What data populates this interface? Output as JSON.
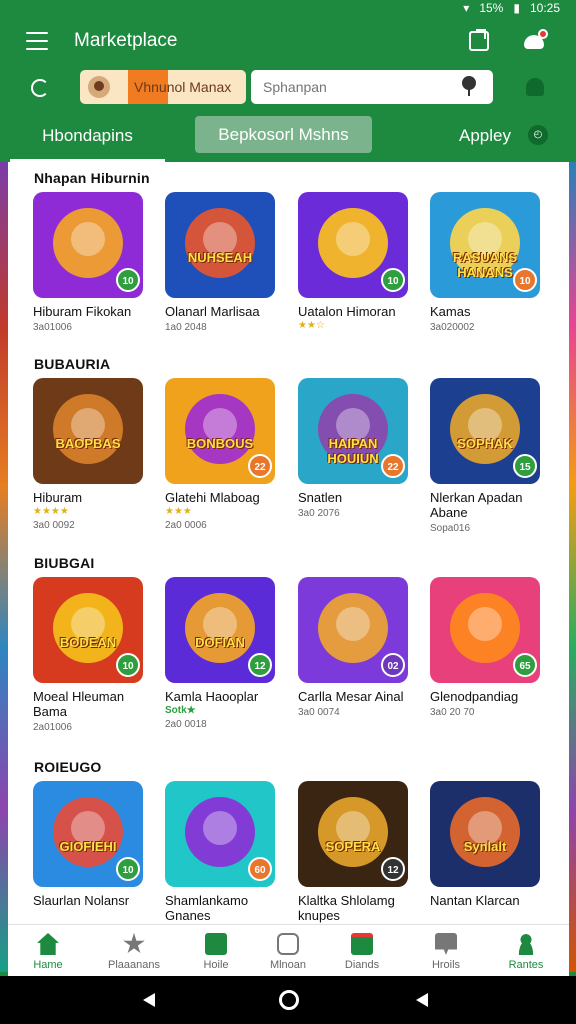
{
  "status_bar": {
    "battery": "15%",
    "time": "10:25"
  },
  "header": {
    "title": "Marketplace"
  },
  "search": {
    "chip_label": "Vhnunol Manax",
    "placeholder": "Sphanpan"
  },
  "tabs": [
    {
      "label": "Hbondapins"
    },
    {
      "label": "Bepkosorl Mshns"
    },
    {
      "label": "Appley"
    }
  ],
  "sections": [
    {
      "title": "Nhapan Hiburnin",
      "apps": [
        {
          "name": "Hiburam Fikokan",
          "meta": "3a01006",
          "rating": "",
          "badge": "10",
          "word": "",
          "bg": "#8e2bd6",
          "glow": "#f5a623",
          "badge_color": "#2e9e3e"
        },
        {
          "name": "Olanarl Marlisaa",
          "meta": "1a0 2048",
          "rating": "",
          "badge": "",
          "word": "NUHSEAH",
          "bg": "#1f4fb8",
          "glow": "#e8552c",
          "badge_color": "#2e9e3e"
        },
        {
          "name": "Uatalon Himoran",
          "meta": "",
          "rating": "★★☆",
          "badge": "10",
          "word": "",
          "bg": "#6c2bd9",
          "glow": "#ffc21a",
          "badge_color": "#2e9e3e"
        },
        {
          "name": "Kamas",
          "meta": "3a020002",
          "rating": "",
          "badge": "10",
          "word": "RASUANS HANANS",
          "bg": "#2a9bd8",
          "glow": "#ffd54a",
          "badge_color": "#e8762c"
        }
      ]
    },
    {
      "title": "BUBAURIA",
      "apps": [
        {
          "name": "Hiburam",
          "meta": "3a0 0092",
          "rating": "★★★★",
          "badge": "",
          "word": "BAOPBAS",
          "bg": "#6e3a17",
          "glow": "#d9822b",
          "badge_color": "#2e9e3e"
        },
        {
          "name": "Glatehi Mlaboag",
          "meta": "2a0 0006",
          "rating": "★★★",
          "badge": "22",
          "word": "BONBOUS",
          "bg": "#f0a21c",
          "glow": "#9c2bd6",
          "badge_color": "#e8762c"
        },
        {
          "name": "Snatlen",
          "meta": "3a0 2076",
          "rating": "",
          "badge": "22",
          "word": "HAIPAN HOUIUN",
          "bg": "#2aa7c8",
          "glow": "#8e44ad",
          "badge_color": "#e8762c"
        },
        {
          "name": "Nlerkan Apadan Abane",
          "meta": "Sopa016",
          "rating": "",
          "badge": "15",
          "word": "SOPHAK",
          "bg": "#1d3f8f",
          "glow": "#e8a52c",
          "badge_color": "#2e9e3e"
        }
      ]
    },
    {
      "title": "BIUBGAI",
      "apps": [
        {
          "name": "Moeal Hleuman Bama",
          "meta": "2a01006",
          "rating": "",
          "badge": "10",
          "word": "BODEAN",
          "bg": "#d63b1f",
          "glow": "#f5c21a",
          "badge_color": "#2e9e3e"
        },
        {
          "name": "Kamla Haooplar",
          "meta": "2a0 0018",
          "rating": "Sotk★",
          "badge": "12",
          "word": "DOFIAN",
          "bg": "#5a2bd6",
          "glow": "#f5a623",
          "badge_color": "#2e9e3e"
        },
        {
          "name": "Carlla Mesar Ainal",
          "meta": "3a0 0074",
          "rating": "",
          "badge": "02",
          "word": "",
          "bg": "#7b3ad9",
          "glow": "#f0a72c",
          "badge_color": "#6c3ab8"
        },
        {
          "name": "Glenodpandiag",
          "meta": "3a0 20 70",
          "rating": "",
          "badge": "65",
          "word": "",
          "bg": "#e8407a",
          "glow": "#ff8a1a",
          "badge_color": "#2e9e3e"
        }
      ]
    },
    {
      "title": "ROIEUGO",
      "apps": [
        {
          "name": "Slaurlan Nolansr",
          "meta": "",
          "rating": "",
          "badge": "10",
          "word": "GIOFIEHI",
          "bg": "#2a8be0",
          "glow": "#e84a3a",
          "badge_color": "#2e9e3e"
        },
        {
          "name": "Shamlankamo Gnanes",
          "meta": "",
          "rating": "",
          "badge": "60",
          "word": "",
          "bg": "#20c6c8",
          "glow": "#8e2bd6",
          "badge_color": "#e8762c"
        },
        {
          "name": "Klaltka Shlolamg knupes",
          "meta": "",
          "rating": "",
          "badge": "12",
          "word": "SOPERA",
          "bg": "#3a2412",
          "glow": "#e8a52c",
          "badge_color": "#333333"
        },
        {
          "name": "Nantan Klarcan",
          "meta": "",
          "rating": "",
          "badge": "",
          "word": "Synlalt",
          "bg": "#1d2f6b",
          "glow": "#e86a2c",
          "badge_color": "#2e9e3e"
        }
      ]
    }
  ],
  "bottom_nav": [
    {
      "label": "Hame",
      "icon": "home-icon",
      "active": true
    },
    {
      "label": "Plaaanans",
      "icon": "star-icon",
      "active": false
    },
    {
      "label": "Hoile",
      "icon": "grid-icon",
      "active": false
    },
    {
      "label": "Mlnoan",
      "icon": "game-icon",
      "active": false
    },
    {
      "label": "Diands",
      "icon": "badge-icon",
      "active": false
    },
    {
      "label": "Hroils",
      "icon": "chat-icon",
      "active": false
    },
    {
      "label": "Rantes",
      "icon": "person-icon",
      "active": true
    }
  ],
  "colors": {
    "brand_green": "#1d8a3f",
    "accent": "#f07b20"
  }
}
